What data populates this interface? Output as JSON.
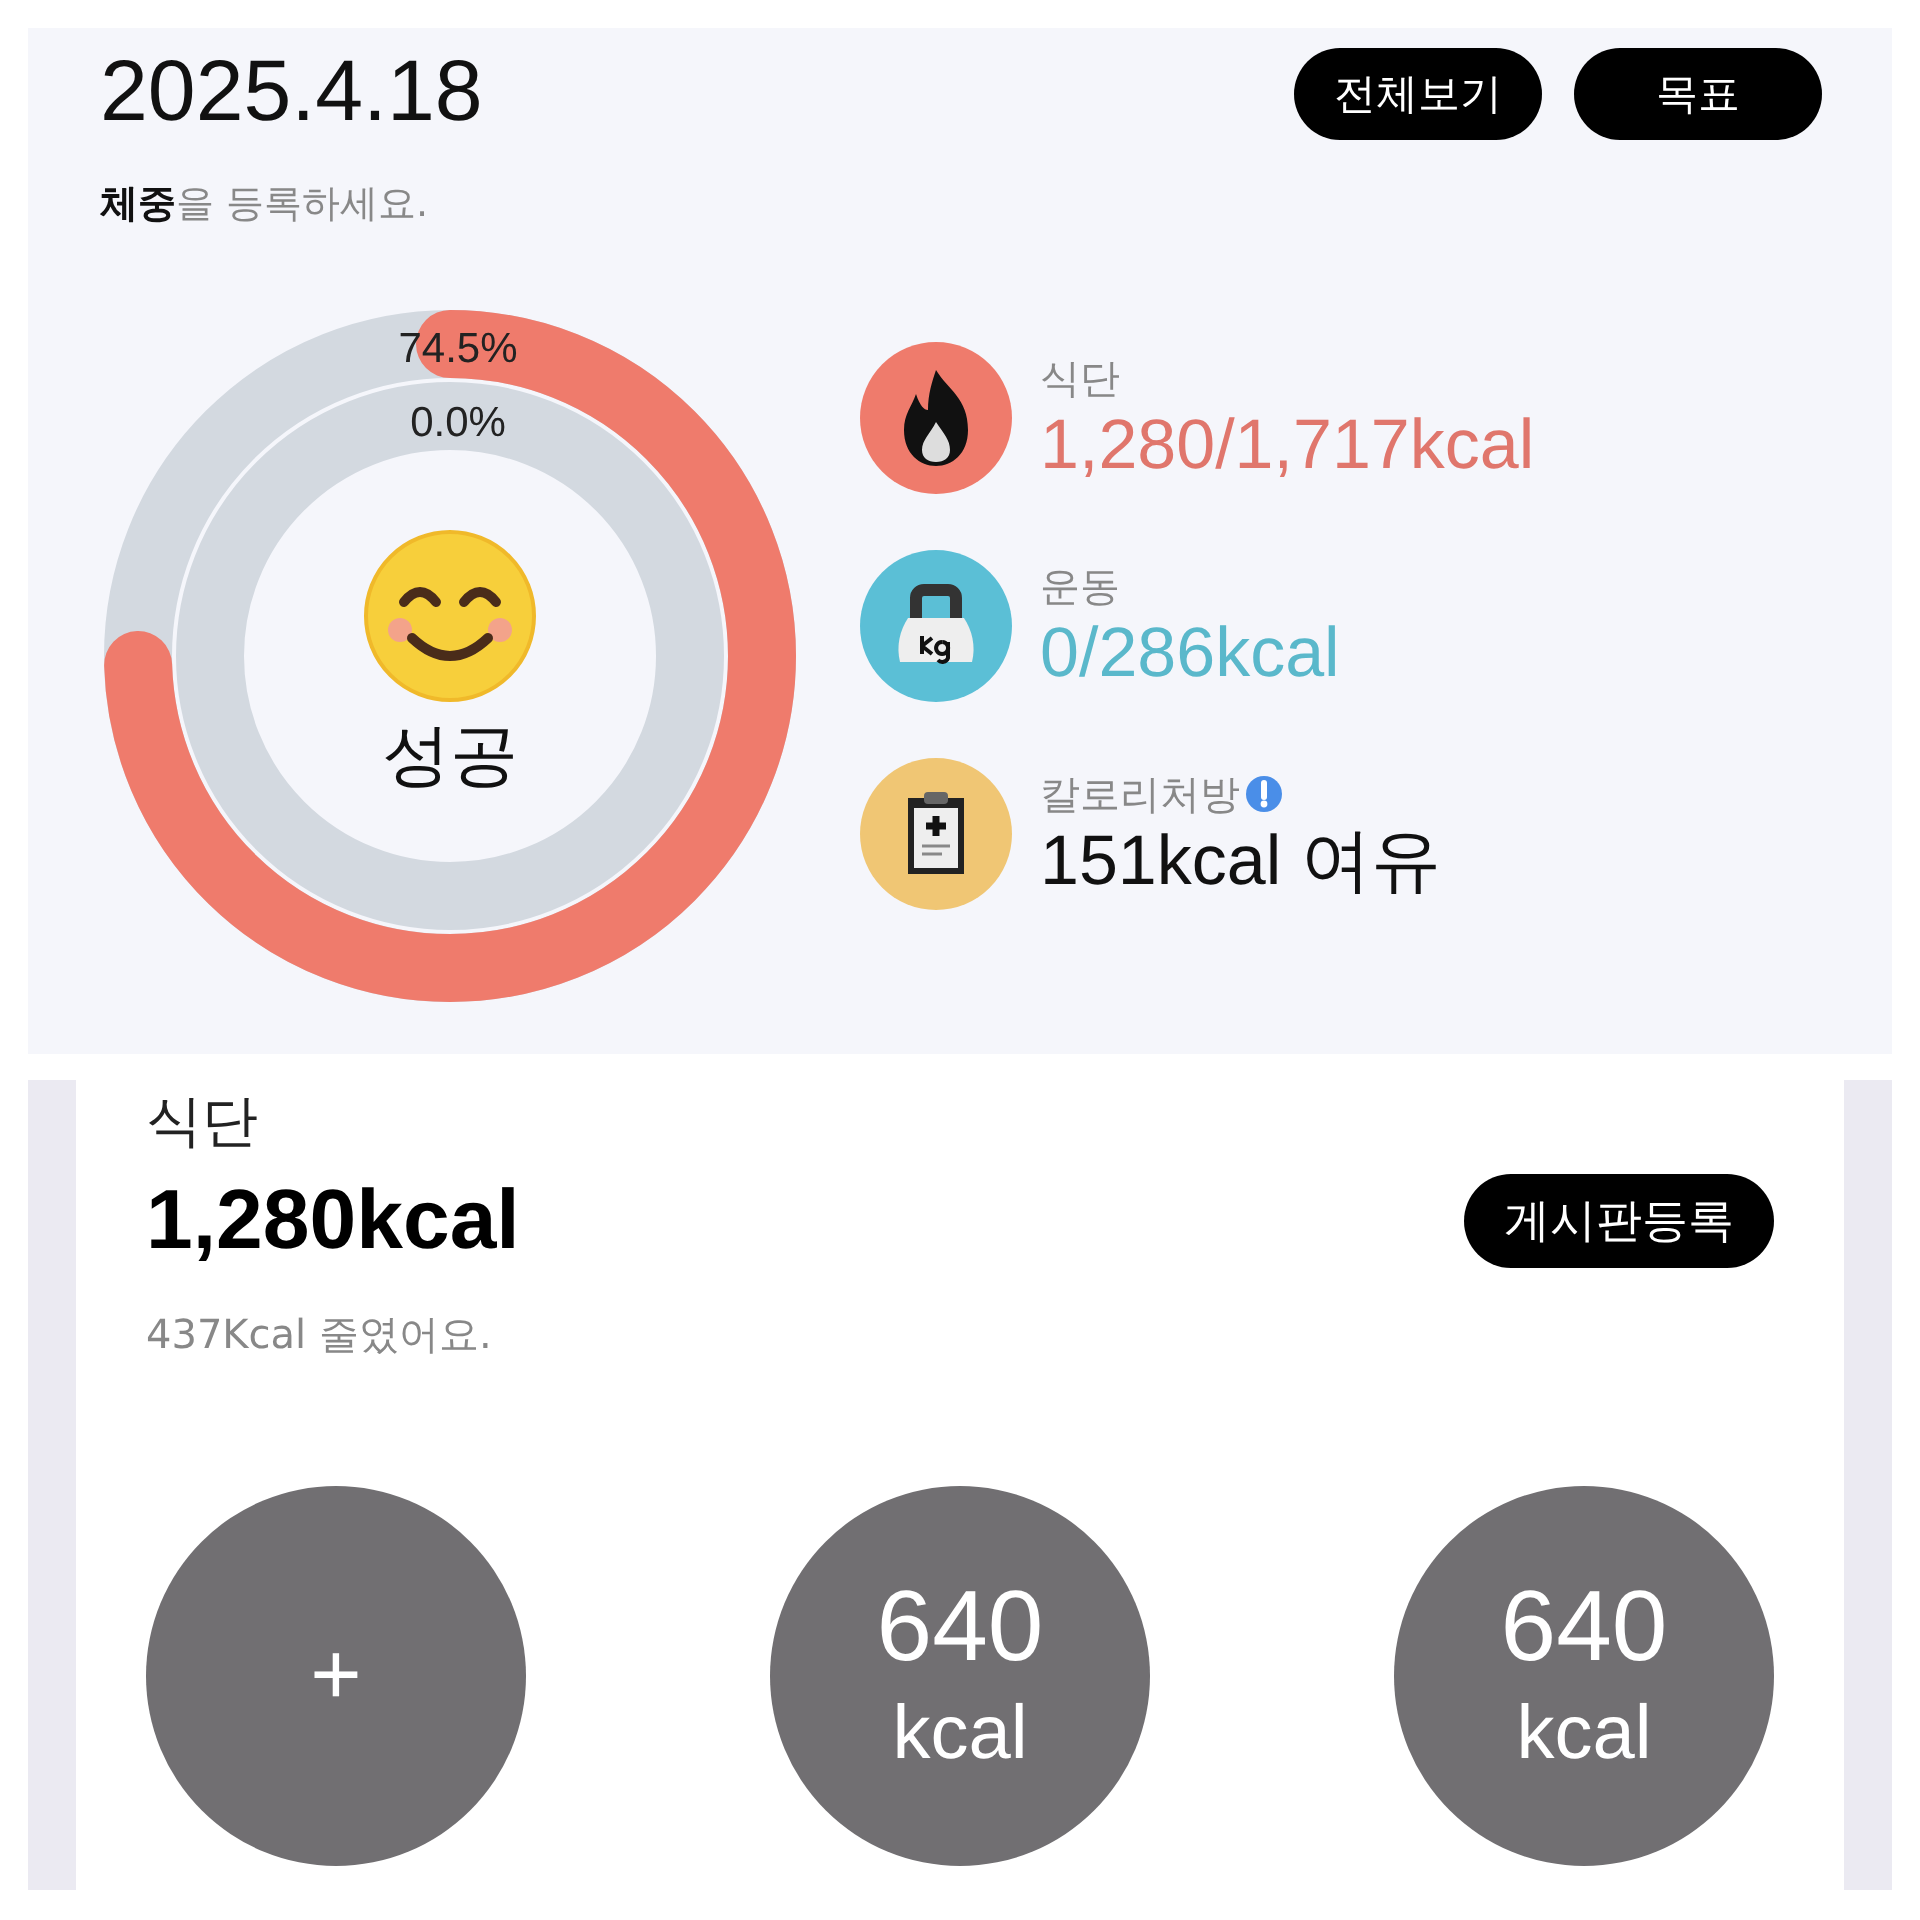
{
  "header": {
    "date": "2025.4.18",
    "buttons": [
      "전체보기",
      "목표"
    ],
    "prompt": "**체중**을 등록하세요."
  },
  "rings": [
    {
      "reading": "74.5%",
      "level": 0.745
    },
    {
      "reading": "0.0%",
      "level": 0
    }
  ],
  "status": "성공",
  "summary": [
    {
      "kind": "diet",
      "label": "식단",
      "value": "1,280/1,717kcal",
      "info": false
    },
    {
      "kind": "exercise",
      "label": "운동",
      "value": "0/286kcal",
      "info": false
    },
    {
      "kind": "prescription",
      "label": "칼로리처방",
      "value": "151kcal 여유",
      "info": true
    }
  ],
  "meal_card": {
    "title": "식단",
    "total": "1,280kcal",
    "button": "게시판등록",
    "note": "437Kcal 줄였어요.",
    "meals": [
      {
        "kind": "add",
        "label": "+"
      },
      {
        "kind": "entry",
        "amount": "640",
        "unit": "kcal"
      },
      {
        "kind": "entry",
        "amount": "640",
        "unit": "kcal"
      }
    ]
  }
}
